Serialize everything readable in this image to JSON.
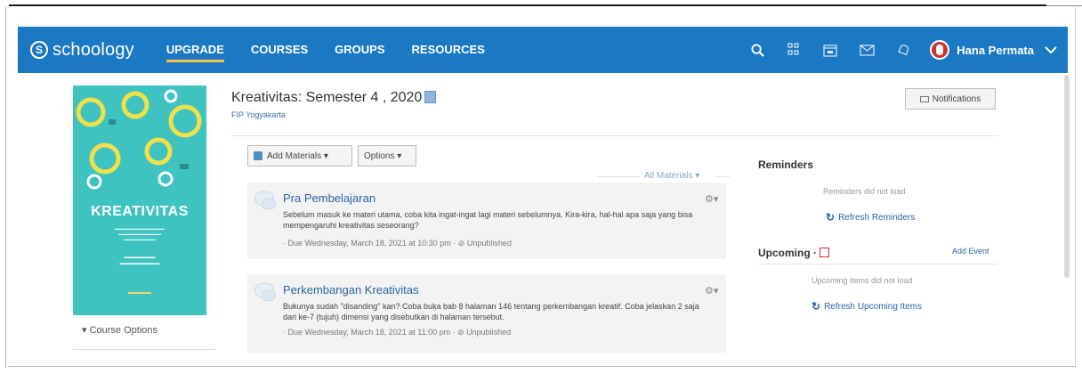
{
  "nav": {
    "logo_text": "schoology",
    "logo_letter": "S",
    "links": [
      "UPGRADE",
      "COURSES",
      "GROUPS",
      "RESOURCES"
    ],
    "user_name": "Hana Permata",
    "icons": [
      "search-icon",
      "apps-icon",
      "calendar-icon",
      "mail-icon",
      "bell-icon"
    ],
    "colors": {
      "bar": "#1b78c2",
      "active_underline": "#f5c244"
    }
  },
  "cover": {
    "title": "KREATIVITAS",
    "background": "#3ec3c1"
  },
  "sidebar": {
    "course_options": "Course Options"
  },
  "course": {
    "title": "Kreativitas: Semester 4 , 2020",
    "subtitle": "FIP Yogyakarta"
  },
  "header": {
    "notifications_label": "Notifications"
  },
  "toolbar": {
    "add_materials": "Add Materials ▾",
    "options": "Options ▾",
    "filter": "All Materials ▾"
  },
  "materials": [
    {
      "title": "Pra Pembelajaran",
      "description": "Sebelum masuk ke materi utama, coba kita ingat-ingat lagi materi sebelumnya. Kira-kira, hal-hal apa saja yang bisa mempengaruhi kreativitas seseorang?",
      "due": "· Due Wednesday, March 18, 2021 at 10:30 pm · ⊘ Unpublished"
    },
    {
      "title": "Perkembangan Kreativitas",
      "description": "Bukunya sudah \"disanding\" kan? Coba buka bab 8 halaman 146 tentang perkembangan kreatif. Coba jelaskan 2 saja dari ke-7 (tujuh) dimensi yang disebutkan di halaman tersebut.",
      "due": "· Due Wednesday, March 18, 2021 at 11:00 pm · ⊘ Unpublished"
    }
  ],
  "reminders": {
    "title": "Reminders",
    "message": "Reminders did not load",
    "refresh": "Refresh Reminders"
  },
  "upcoming": {
    "title": "Upcoming ·",
    "add_event": "Add Event",
    "message": "Upcoming items did not load",
    "refresh": "Refresh Upcoming Items"
  }
}
